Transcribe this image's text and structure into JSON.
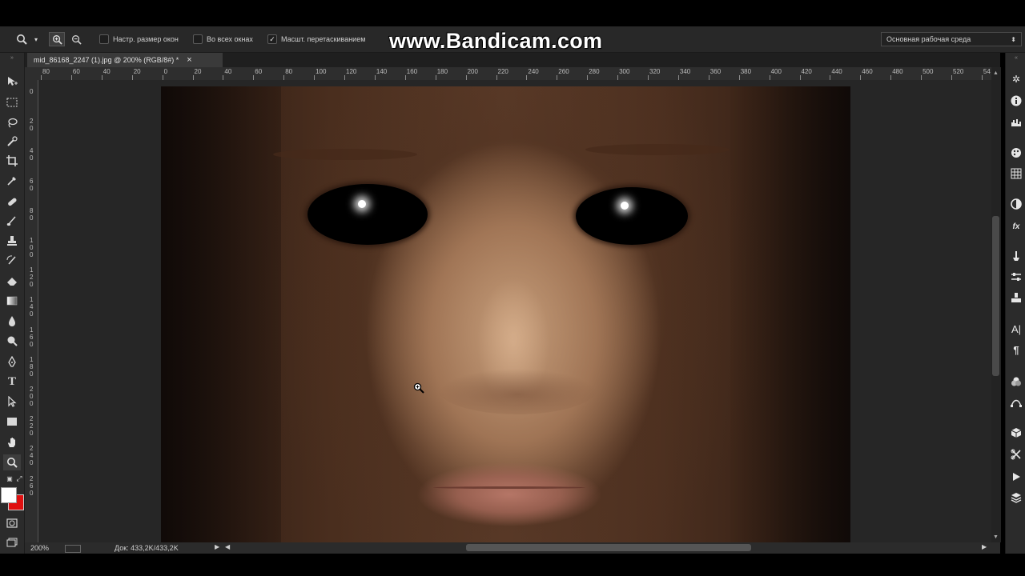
{
  "watermark": "www.Bandicam.com",
  "options": {
    "resize_windows": "Настр. размер окон",
    "all_windows": "Во всех окнах",
    "scrubby_zoom": "Масшт. перетаскиванием",
    "scrubby_zoom_checked": true,
    "workspace": "Основная рабочая среда"
  },
  "document": {
    "tab_title": "mid_86168_2247 (1).jpg @ 200% (RGB/8#) *",
    "tab_close": "×"
  },
  "ruler": {
    "horizontal_labels": [
      "80",
      "60",
      "40",
      "20",
      "0",
      "20",
      "40",
      "60",
      "80",
      "100",
      "120",
      "140",
      "160",
      "180",
      "200",
      "220",
      "240",
      "260",
      "280",
      "300",
      "320",
      "340",
      "360",
      "380",
      "400",
      "420",
      "440",
      "460",
      "480",
      "500",
      "520",
      "54"
    ],
    "vertical_labels": [
      "0",
      "20",
      "40",
      "60",
      "80",
      "100",
      "120",
      "140",
      "160",
      "180",
      "200",
      "220",
      "240",
      "260"
    ]
  },
  "status": {
    "zoom": "200%",
    "doc_size": "Док: 433,2K/433,2K"
  },
  "colors": {
    "foreground": "#ffffff",
    "background": "#e01010"
  },
  "icons": {
    "toolbar": [
      "move-icon",
      "marquee-icon",
      "lasso-icon",
      "quick-select-icon",
      "crop-icon",
      "eyedropper-icon",
      "healing-brush-icon",
      "brush-icon",
      "clone-stamp-icon",
      "history-brush-icon",
      "eraser-icon",
      "gradient-icon",
      "blur-icon",
      "dodge-icon",
      "pen-icon",
      "type-icon",
      "path-select-icon",
      "shape-icon",
      "hand-icon",
      "zoom-icon"
    ],
    "right_panel": [
      "navigator-icon",
      "info-icon",
      "histogram-icon",
      "color-icon",
      "swatches-icon",
      "adjustments-icon",
      "styles-icon",
      "brush-presets-icon",
      "tool-presets-icon",
      "clone-source-icon",
      "character-icon",
      "paragraph-icon",
      "channels-icon",
      "paths-icon",
      "3d-icon",
      "timeline-icon",
      "actions-icon",
      "layers-icon"
    ]
  }
}
